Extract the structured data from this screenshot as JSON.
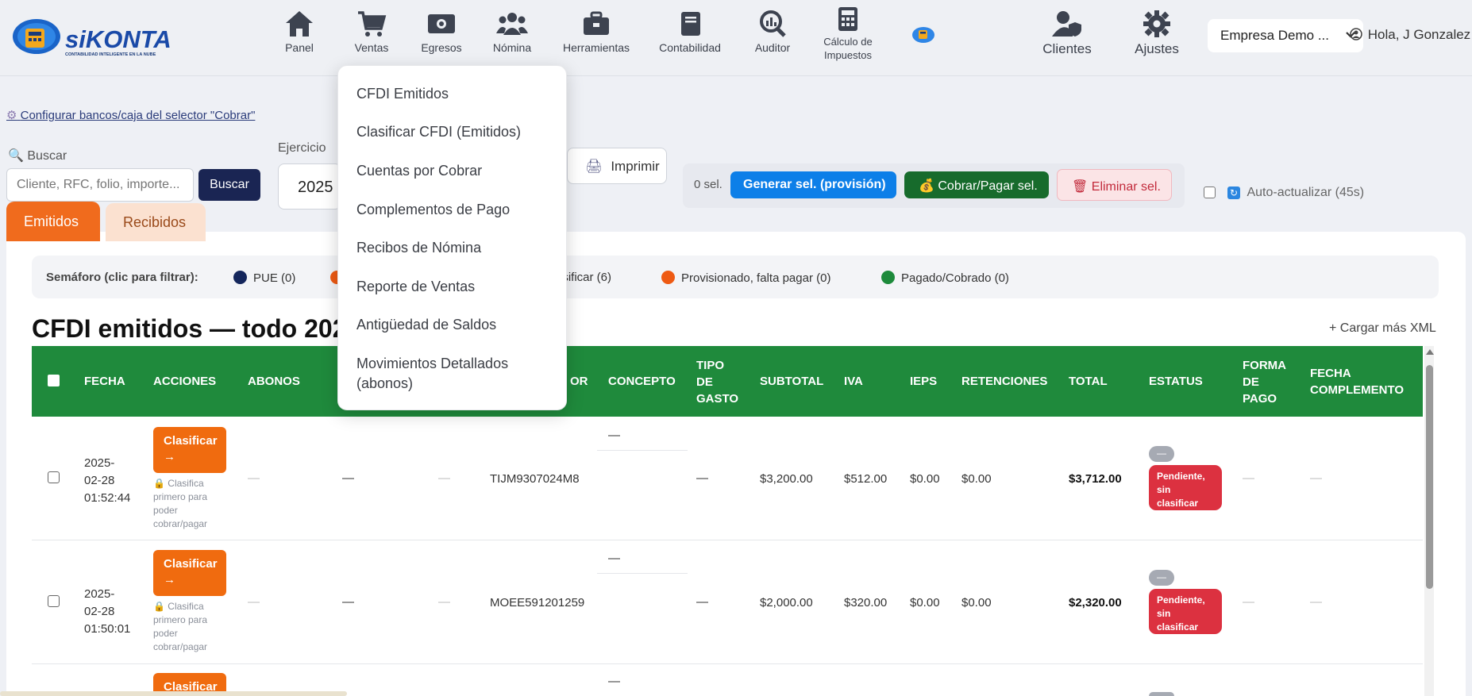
{
  "app": {
    "logo_text": "siKONTA",
    "logo_tagline": "CONTABILIDAD INTELIGENTE EN LA NUBE"
  },
  "nav": {
    "panel": "Panel",
    "ventas": "Ventas",
    "egresos": "Egresos",
    "nomina": "Nómina",
    "herramientas": "Herramientas",
    "contabilidad": "Contabilidad",
    "auditor": "Auditor",
    "calculo_line1": "Cálculo de",
    "calculo_line2": "Impuestos",
    "clientes": "Clientes",
    "ajustes": "Ajustes"
  },
  "company": {
    "selected": "Empresa Demo ..."
  },
  "user": {
    "greeting": "Hola, J Gonzalez"
  },
  "config_link": "Configurar bancos/caja del selector \"Cobrar\"",
  "search": {
    "label": "Buscar",
    "placeholder": "Cliente, RFC, folio, importe...",
    "button": "Buscar"
  },
  "ejercicio": {
    "label": "Ejercicio",
    "value": "2025"
  },
  "toolbar": {
    "print": "Imprimir",
    "sel_count": "0 sel.",
    "generar": "Generar sel. (provisión)",
    "cobrar": "Cobrar/Pagar sel.",
    "eliminar": "Eliminar sel.",
    "auto_refresh": "Auto-actualizar (45s)"
  },
  "tabs": {
    "emitidos": "Emitidos",
    "recibidos": "Recibidos"
  },
  "semaforo": {
    "label": "Semáforo (clic para filtrar):",
    "pue": "PUE (0)",
    "clasificar": "asificar (6)",
    "provisionado": "Provisionado, falta pagar (0)",
    "pagado": "Pagado/Cobrado (0)",
    "colors": {
      "pue": "#14265c",
      "provisionado": "#ee5a13",
      "pagado": "#1d8a3b",
      "hidden": "#ee5a13"
    }
  },
  "title": "CFDI emitidos — todo 202",
  "load_more": "+ Cargar más XML",
  "table": {
    "headers": {
      "fecha": "FECHA",
      "acciones": "ACCIONES",
      "abonos": "ABONOS",
      "receptor_tail": "OR",
      "concepto": "CONCEPTO",
      "tipo_gasto_1": "TIPO",
      "tipo_gasto_2": "DE",
      "tipo_gasto_3": "GASTO",
      "subtotal": "SUBTOTAL",
      "iva": "IVA",
      "ieps": "IEPS",
      "retenciones": "RETENCIONES",
      "total": "TOTAL",
      "estatus": "ESTATUS",
      "forma_1": "FORMA",
      "forma_2": "DE",
      "forma_3": "PAGO",
      "fecha_comp_1": "FECHA",
      "fecha_comp_2": "COMPLEMENTO"
    },
    "rows": [
      {
        "date": "2025-",
        "date2": "02-28",
        "time": "01:52:44",
        "action_line1": "Clasificar",
        "action_line2": "→",
        "note1": "🔒 Clasifica",
        "note2": "primero para",
        "note3": "poder",
        "note4": "cobrar/pagar",
        "dash": "—",
        "rfc": "TIJM9307024M8",
        "subtotal": "$3,200.00",
        "iva": "$512.00",
        "ieps": "$0.00",
        "retenciones": "$0.00",
        "total": "$3,712.00",
        "status_small": "—",
        "status_1": "Pendiente,",
        "status_2": "sin",
        "status_3": "clasificar"
      },
      {
        "date": "2025-",
        "date2": "02-28",
        "time": "01:50:01",
        "action_line1": "Clasificar",
        "action_line2": "→",
        "note1": "🔒 Clasifica",
        "note2": "primero para",
        "note3": "poder",
        "note4": "cobrar/pagar",
        "dash": "—",
        "rfc": "MOEE591201259",
        "subtotal": "$2,000.00",
        "iva": "$320.00",
        "ieps": "$0.00",
        "retenciones": "$0.00",
        "total": "$2,320.00",
        "status_small": "—",
        "status_1": "Pendiente,",
        "status_2": "sin",
        "status_3": "clasificar"
      },
      {
        "action_line1": "Clasificar",
        "dash": "—"
      }
    ]
  },
  "ventas_menu": {
    "items": [
      "CFDI Emitidos",
      "Clasificar CFDI (Emitidos)",
      "Cuentas por Cobrar",
      "Complementos de Pago",
      "Recibos de Nómina",
      "Reporte de Ventas",
      "Antigüedad de Saldos",
      "Movimientos Detallados",
      "(abonos)"
    ]
  }
}
